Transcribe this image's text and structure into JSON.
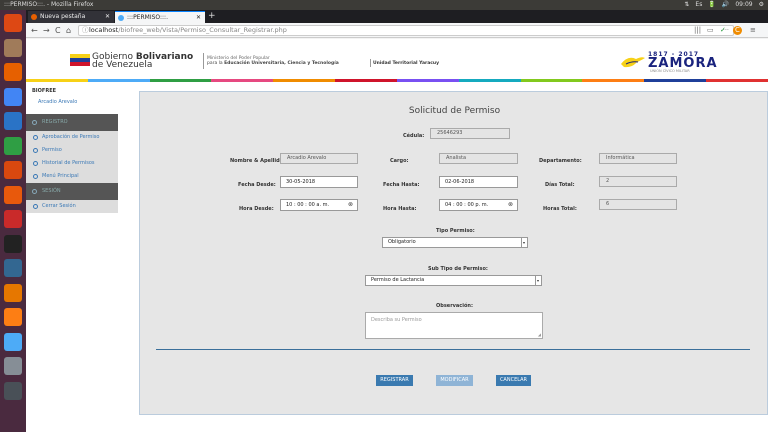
{
  "os": {
    "window_title": ":::PERMISO:::. - Mozilla Firefox",
    "tray": [
      "⇅",
      "Es",
      "🔋",
      "🔊",
      "09:09",
      "⚙"
    ]
  },
  "launcher": {
    "icons": [
      {
        "name": "ubuntu-dash-icon",
        "color": "#dd4814"
      },
      {
        "name": "files-icon",
        "color": "#a07b5a"
      },
      {
        "name": "firefox-icon",
        "color": "#e66000"
      },
      {
        "name": "chrome-icon",
        "color": "#4285f4"
      },
      {
        "name": "writer-icon",
        "color": "#2a73c6"
      },
      {
        "name": "calc-icon",
        "color": "#2f9e44"
      },
      {
        "name": "impress-icon",
        "color": "#d9480f"
      },
      {
        "name": "software-center-icon",
        "color": "#e8590c"
      },
      {
        "name": "settings-icon",
        "color": "#c92a2a"
      },
      {
        "name": "terminal-icon",
        "color": "#222222"
      },
      {
        "name": "pgadmin-icon",
        "color": "#336791"
      },
      {
        "name": "archive-icon",
        "color": "#e67700"
      },
      {
        "name": "sublime-icon",
        "color": "#fd7e14"
      },
      {
        "name": "virtualbox-icon",
        "color": "#4dabf7"
      },
      {
        "name": "system-monitor-icon",
        "color": "#868e96"
      },
      {
        "name": "trash-icon",
        "color": "#495057"
      }
    ]
  },
  "browser": {
    "tabs": [
      {
        "label": "Nueva pestaña",
        "fav_color": "#e66000"
      },
      {
        "label": ":::PERMISO:::.",
        "fav_color": "#4dabf7"
      }
    ],
    "new_tab": "+",
    "url_host": "localhost",
    "url_path": "/biofree_web/Vista/Permiso_Consultar_Registrar.php",
    "back": "←",
    "forward": "→",
    "reload": "C",
    "home": "⌂",
    "url_more": "···",
    "info_icon": "ⓘ",
    "right_icons": [
      "|||",
      "▭",
      "✓",
      "C",
      "≡"
    ]
  },
  "banner": {
    "gov_line1_a": "Gobierno ",
    "gov_line1_b": "Bolivariano",
    "gov_line2": "de Venezuela",
    "ministry_line1": "Ministerio del Poder Popular",
    "ministry_line2_a": "para la ",
    "ministry_line2_b": "Educación Universitaria, Ciencia y Tecnología",
    "unit": "Unidad Territorial Yaracuy",
    "zamora_years": "1817 - 2017",
    "zamora_name": "ZAMORA",
    "zamora_sub": "UNIÓN CÍVICO MILITAR",
    "flag_colors": [
      "#f7d117",
      "#1f3f99",
      "#cf142b"
    ],
    "stripe_colors": [
      "#f7d117",
      "#4dabf7",
      "#2f9e44",
      "#e64980",
      "#f08c00",
      "#cf142b",
      "#7950f2",
      "#15aabf",
      "#82c91e",
      "#fd7e14",
      "#1f3f99",
      "#e03131"
    ]
  },
  "sidebar": {
    "brand": "BIOFREE",
    "user": "Arcadio Arevalo",
    "section1": "REGISTRO",
    "items1": [
      "Aprobación de Permiso",
      "Permiso",
      "Historial de Permisos",
      "Menú Principal"
    ],
    "section2": "SESIÓN",
    "items2": [
      "Cerrar Sesión"
    ]
  },
  "form": {
    "title": "Solicitud de Permiso",
    "cedula_label": "Cédula:",
    "cedula": "25646293",
    "nombre_label": "Nombre & Apellido:",
    "nombre": "Arcadio Arevalo",
    "cargo_label": "Cargo:",
    "cargo": "Analista",
    "depto_label": "Departamento:",
    "depto": "Informática",
    "fecha_desde_label": "Fecha Desde:",
    "fecha_desde": "30-05-2018",
    "fecha_hasta_label": "Fecha Hasta:",
    "fecha_hasta": "02-06-2018",
    "dias_label": "Días Total:",
    "dias": "2",
    "hora_desde_label": "Hora Desde:",
    "hora_desde": "10 : 00 : 00   a. m.",
    "hora_hasta_label": "Hora Hasta:",
    "hora_hasta": "04 : 00 : 00   p. m.",
    "horas_label": "Horas Total:",
    "horas": "6",
    "clock_icon": "⊗",
    "tipo_label": "Tipo Permiso:",
    "tipo": "Obligatorio",
    "subtipo_label": "Sub Tipo de Permiso:",
    "subtipo": "Permiso de Lactancia",
    "obs_label": "Observación:",
    "obs_placeholder": "Describa su Permiso",
    "select_arrow": "▾",
    "grip": "◢"
  },
  "buttons": {
    "registrar": "REGISTRAR",
    "modificar": "MODIFICAR",
    "cancelar": "CANCELAR"
  },
  "colors": {
    "button_primary": "#3a7ab0",
    "button_disabled": "#8fb4d6",
    "launcher_bg": "#4a2a3f"
  }
}
